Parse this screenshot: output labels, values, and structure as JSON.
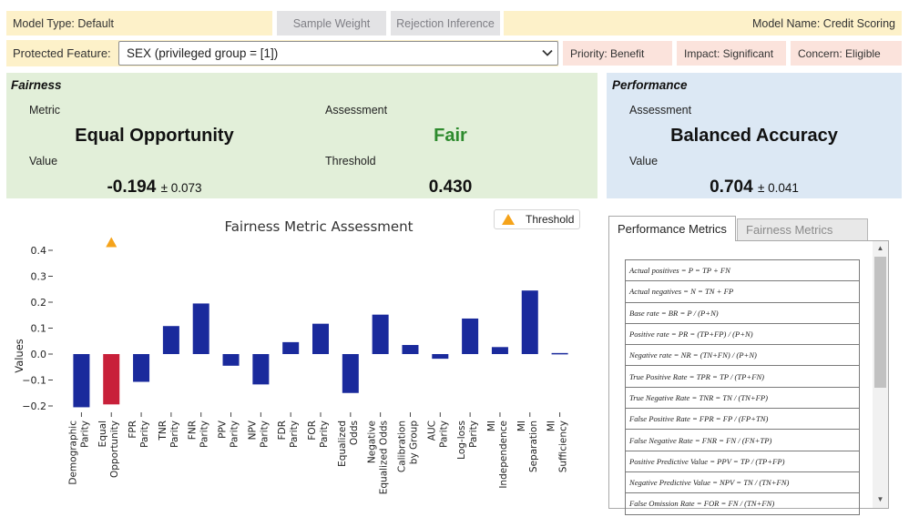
{
  "header": {
    "model_type": "Model Type: Default",
    "sample_weight_btn": "Sample Weight",
    "rejection_inference_btn": "Rejection Inference",
    "model_name": "Model Name: Credit Scoring"
  },
  "feature_row": {
    "protected_feature_label": "Protected Feature:",
    "selected_feature": "SEX (privileged group = [1])",
    "priority": "Priority: Benefit",
    "impact": "Impact: Significant",
    "concern": "Concern: Eligible"
  },
  "fairness": {
    "title": "Fairness",
    "metric_label": "Metric",
    "metric": "Equal Opportunity",
    "assessment_label": "Assessment",
    "assessment": "Fair",
    "value_label": "Value",
    "value": "-0.194",
    "value_error": "± 0.073",
    "threshold_label": "Threshold",
    "threshold": "0.430"
  },
  "performance": {
    "title": "Performance",
    "assessment_label": "Assessment",
    "assessment": "Balanced Accuracy",
    "value_label": "Value",
    "value": "0.704",
    "value_error": "± 0.041"
  },
  "colors": {
    "bar": "#1a2a9c",
    "highlight_bar": "#c8203a",
    "threshold_marker": "#f5a31a",
    "fair_text": "#2e8b2e",
    "fairness_bg": "#e2efd9",
    "performance_bg": "#dce8f4"
  },
  "chart_data": {
    "type": "bar",
    "title": "Fairness Metric Assessment",
    "ylabel": "Values",
    "ylim": [
      -0.2,
      0.45
    ],
    "yticks": [
      "0.4",
      "0.3",
      "0.2",
      "0.1",
      "0.0",
      "−0.1",
      "−0.2"
    ],
    "ytick_values": [
      0.4,
      0.3,
      0.2,
      0.1,
      0.0,
      -0.1,
      -0.2
    ],
    "categories": [
      [
        "Demographic",
        "Parity"
      ],
      [
        "Equal",
        "Opportunity"
      ],
      [
        "FPR",
        "Parity"
      ],
      [
        "TNR",
        "Parity"
      ],
      [
        "FNR",
        "Parity"
      ],
      [
        "PPV",
        "Parity"
      ],
      [
        "NPV",
        "Parity"
      ],
      [
        "FDR",
        "Parity"
      ],
      [
        "FOR",
        "Parity"
      ],
      [
        "Equalized",
        "Odds"
      ],
      [
        "Negative",
        "Equalized Odds"
      ],
      [
        "Calibration",
        "by Group"
      ],
      [
        "AUC",
        "Parity"
      ],
      [
        "Log-loss",
        "Parity"
      ],
      [
        "MI",
        "Independence"
      ],
      [
        "MI",
        "Separation"
      ],
      [
        "MI",
        "Sufficiency"
      ]
    ],
    "values": [
      -0.205,
      -0.194,
      -0.107,
      0.108,
      0.195,
      -0.045,
      -0.117,
      0.046,
      0.117,
      -0.15,
      0.152,
      0.035,
      -0.018,
      0.137,
      0.027,
      0.245,
      0.004
    ],
    "highlight_index": 1,
    "threshold": {
      "label": "Threshold",
      "index": 1,
      "value": 0.43
    },
    "legend": "top-right"
  },
  "tabs": {
    "performance": "Performance Metrics",
    "fairness": "Fairness Metrics"
  },
  "formulas": [
    "Actual positives = P = TP + FN",
    "Actual negatives = N = TN + FP",
    "Base rate = BR = P / (P+N)",
    "Positive rate = PR = (TP+FP) / (P+N)",
    "Negative rate = NR = (TN+FN) / (P+N)",
    "True Positive Rate = TPR = TP / (TP+FN)",
    "True Negative Rate = TNR = TN / (TN+FP)",
    "False Positive Rate = FPR = FP / (FP+TN)",
    "False Negative Rate = FNR = FN / (FN+TP)",
    "Positive Predictive Value = PPV = TP / (TP+FP)",
    "Negative Predictive Value = NPV = TN / (TN+FN)",
    "False Omission Rate = FOR = FN / (TN+FN)"
  ]
}
